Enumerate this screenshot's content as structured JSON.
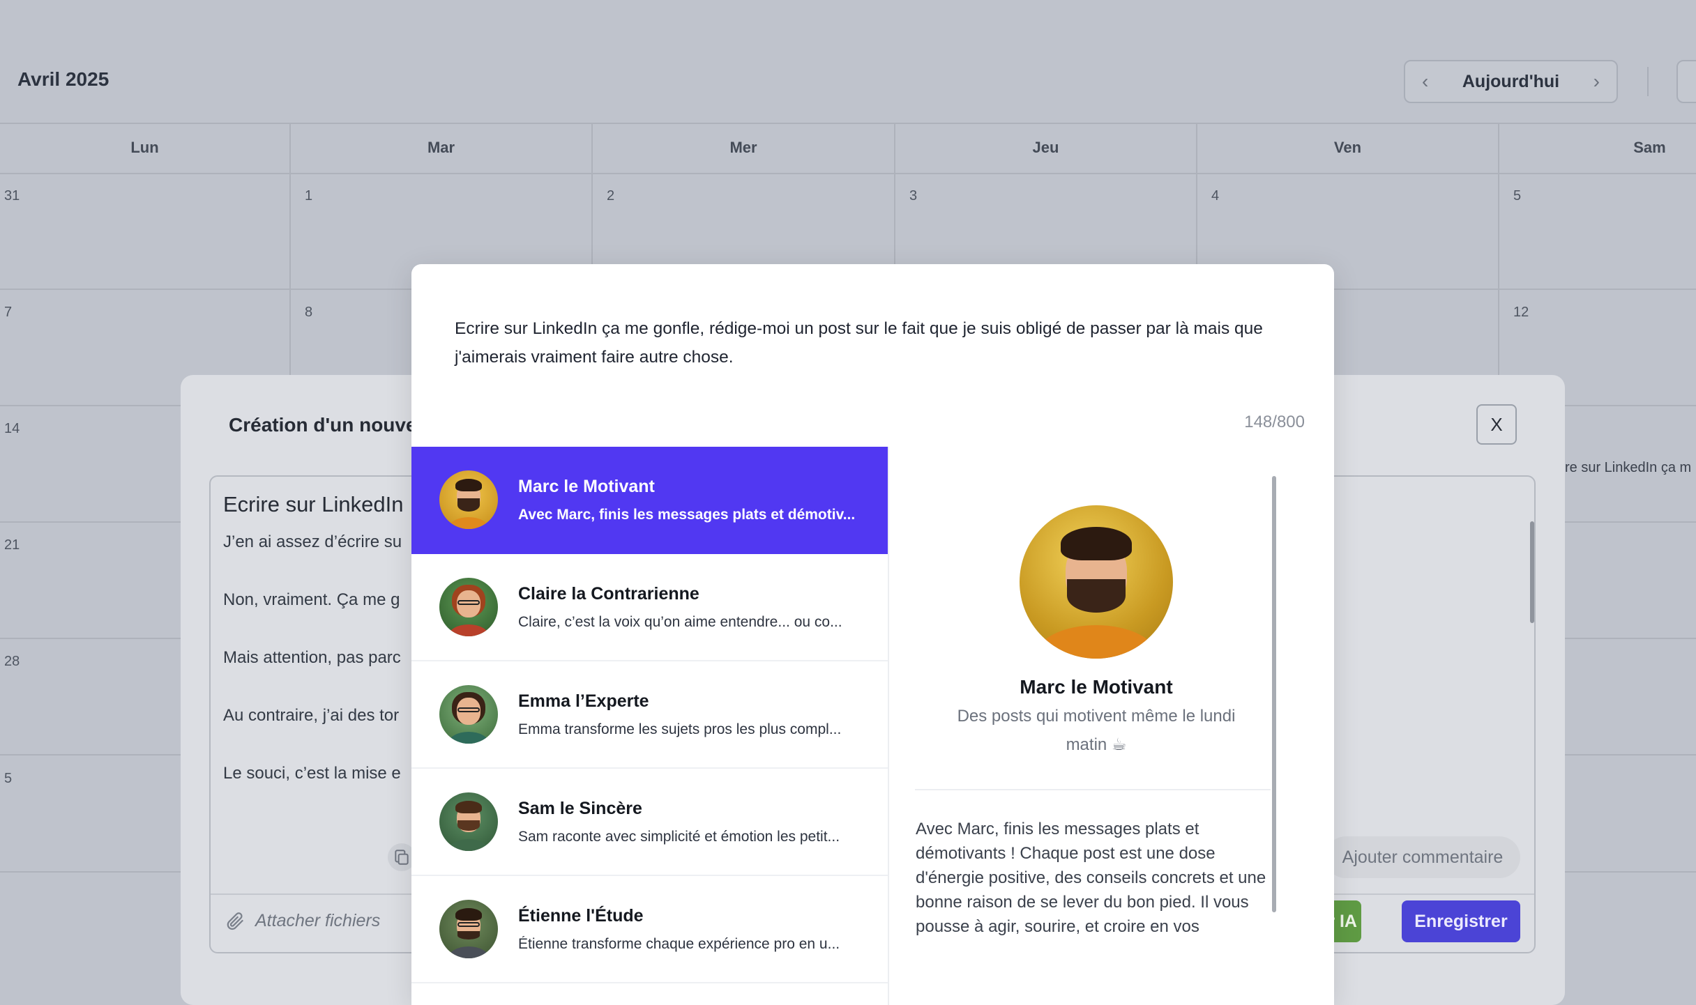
{
  "calendar": {
    "month_title": "Avril 2025",
    "today_label": "Aujourd'hui",
    "prev_icon": "chevron-left-icon",
    "next_icon": "chevron-right-icon",
    "days": [
      "Lun",
      "Mar",
      "Mer",
      "Jeu",
      "Ven",
      "Sam"
    ],
    "dates": {
      "w1": [
        "31",
        "1",
        "2",
        "3",
        "4",
        "5"
      ],
      "w2_lun": "7",
      "w2_mar": "8",
      "w2_sam": "12",
      "w3_lun": "14",
      "w4_lun": "21",
      "w5_lun": "28",
      "w6_lun": "5"
    },
    "event_snippet": "re sur LinkedIn ça m"
  },
  "creation_modal": {
    "title": "Création d'un nouve",
    "close_label": "X",
    "editor_title": "Ecrire sur LinkedIn",
    "lines": [
      "J’en ai assez d’écrire su",
      "Non, vraiment. Ça me g",
      "Mais attention, pas parc",
      "Au contraire, j’ai des tor",
      "Le souci, c’est la mise e"
    ],
    "attach_label": "Attacher fichiers",
    "comment_label": "Ajouter commentaire",
    "ia_label": "par IA",
    "save_label": "Enregistrer"
  },
  "persona_modal": {
    "prompt": "Ecrire sur LinkedIn ça me gonfle, rédige-moi un post sur le fait que je suis obligé de passer par là mais que j'aimerais vraiment faire autre chose.",
    "counter": "148/800",
    "personas": [
      {
        "name": "Marc le Motivant",
        "desc": "Avec Marc, finis les messages plats et démotiv..."
      },
      {
        "name": "Claire la Contrarienne",
        "desc": "Claire, c’est la voix qu’on aime entendre... ou co..."
      },
      {
        "name": "Emma l’Experte",
        "desc": "Emma transforme les sujets pros les plus compl..."
      },
      {
        "name": "Sam le Sincère",
        "desc": "Sam raconte avec simplicité et émotion les petit..."
      },
      {
        "name": "Étienne l'Étude",
        "desc": "Étienne transforme chaque expérience pro en u..."
      }
    ],
    "selected": {
      "name": "Marc le Motivant",
      "tagline": "Des posts qui motivent même le lundi matin ☕",
      "description": "Avec Marc, finis les messages plats et démotivants ! Chaque post est une dose d'énergie positive, des conseils concrets et une bonne raison de se lever du bon pied. Il vous pousse à agir, sourire, et croire en vos"
    }
  },
  "colors": {
    "accent": "#5138f2",
    "save": "#4b44d6",
    "ia": "#5f9b44",
    "overlay": "#bfc3cc"
  }
}
